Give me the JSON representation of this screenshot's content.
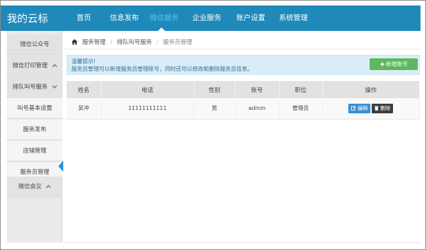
{
  "logo": "我的云标",
  "nav": {
    "items": [
      {
        "label": "首页"
      },
      {
        "label": "信息发布"
      },
      {
        "label": "微信服务"
      },
      {
        "label": "企业服务"
      },
      {
        "label": "账户设置"
      },
      {
        "label": "系统管理"
      }
    ],
    "active_index": 2
  },
  "sidebar": {
    "items": [
      {
        "label": "微信公众号",
        "chevron": ""
      },
      {
        "label": "微信打印管理",
        "chevron": "^"
      },
      {
        "label": "排队叫号服务",
        "chevron": "v"
      },
      {
        "label": "叫号基本设置"
      },
      {
        "label": "服务发布"
      },
      {
        "label": "店铺管理"
      },
      {
        "label": "服务员管理"
      },
      {
        "label": "微信会议",
        "chevron": "^"
      }
    ]
  },
  "breadcrumb": {
    "items": [
      "服务管理",
      "排队叫号服务",
      "服务员管理"
    ]
  },
  "notice": {
    "title": "温馨提示!",
    "text": "服务员管理可以新增服务员管理账号，同时还可以修改和删除服务员信息。"
  },
  "add_button": "新增账号",
  "table": {
    "headers": [
      "姓名",
      "电话",
      "性别",
      "账号",
      "职位",
      "操作"
    ],
    "rows": [
      {
        "name": "吴冲",
        "phone": "11111111111",
        "gender": "男",
        "account": "admin",
        "position": "管理员",
        "edit": "编辑",
        "delete": "删除"
      }
    ]
  },
  "colors": {
    "topbar": "#1f89ba",
    "nav_active": "#58c0ef",
    "add_button": "#5cb85c",
    "edit_button": "#3b8fd0",
    "delete_button": "#3d3d3d",
    "notice_bg": "#d9edf7"
  }
}
